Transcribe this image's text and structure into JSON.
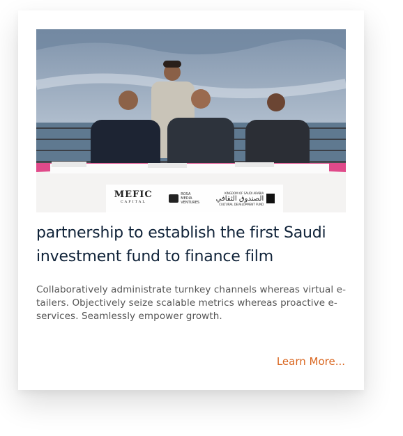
{
  "card": {
    "image_alt": "Signing ceremony at a seaside venue",
    "logos": {
      "mefic": "MEFIC",
      "mefic_sub": "CAPITAL",
      "rsv_line1": "ROSA",
      "rsv_line2": "MEDIA",
      "rsv_line3": "VENTURES",
      "cdf_top": "KINGDOM OF SAUDI ARABIA",
      "cdf_ar": "الصندوق الثقافي",
      "cdf_en": "CULTURAL DEVELOPMENT FUND"
    },
    "title": "partnership to establish the first Saudi investment fund to finance film",
    "description": "Collaboratively administrate turnkey channels whereas virtual e-tailers. Objectively seize scalable metrics whereas proactive e-services. Seamlessly empower growth.",
    "link_label": "Learn More...",
    "accent_color": "#d9651e",
    "title_color": "#0f2238"
  }
}
